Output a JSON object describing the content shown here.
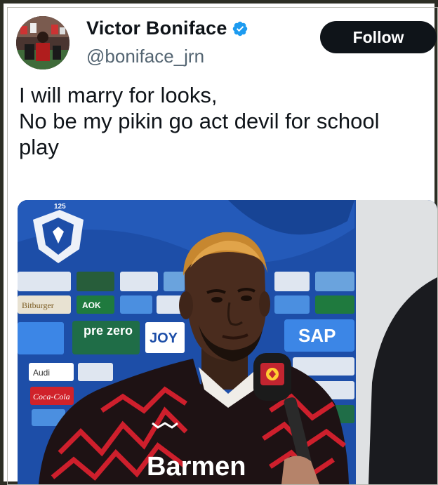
{
  "tweet": {
    "author_name": "Victor Boniface",
    "handle": "@boniface_jrn",
    "follow_label": "Follow",
    "text_lines": [
      "I will marry for looks,",
      "No be my pikin go act devil for school",
      "play"
    ]
  },
  "media": {
    "sponsor_boards": {
      "prezero": "pre zero",
      "sap": "SAP",
      "aok": "AOK",
      "audi": "Audi",
      "cocacola": "Coca-Cola",
      "bitburger": "Bitburger",
      "joy": "JOY"
    },
    "crest_number": "125",
    "jersey_text": "Barmen"
  },
  "colors": {
    "follow_bg": "#0f1419",
    "verified": "#1d9bf0",
    "handle": "#536471",
    "backdrop": "#1d4ea8"
  },
  "icons": [
    "verified-badge-icon",
    "microphone-icon"
  ]
}
